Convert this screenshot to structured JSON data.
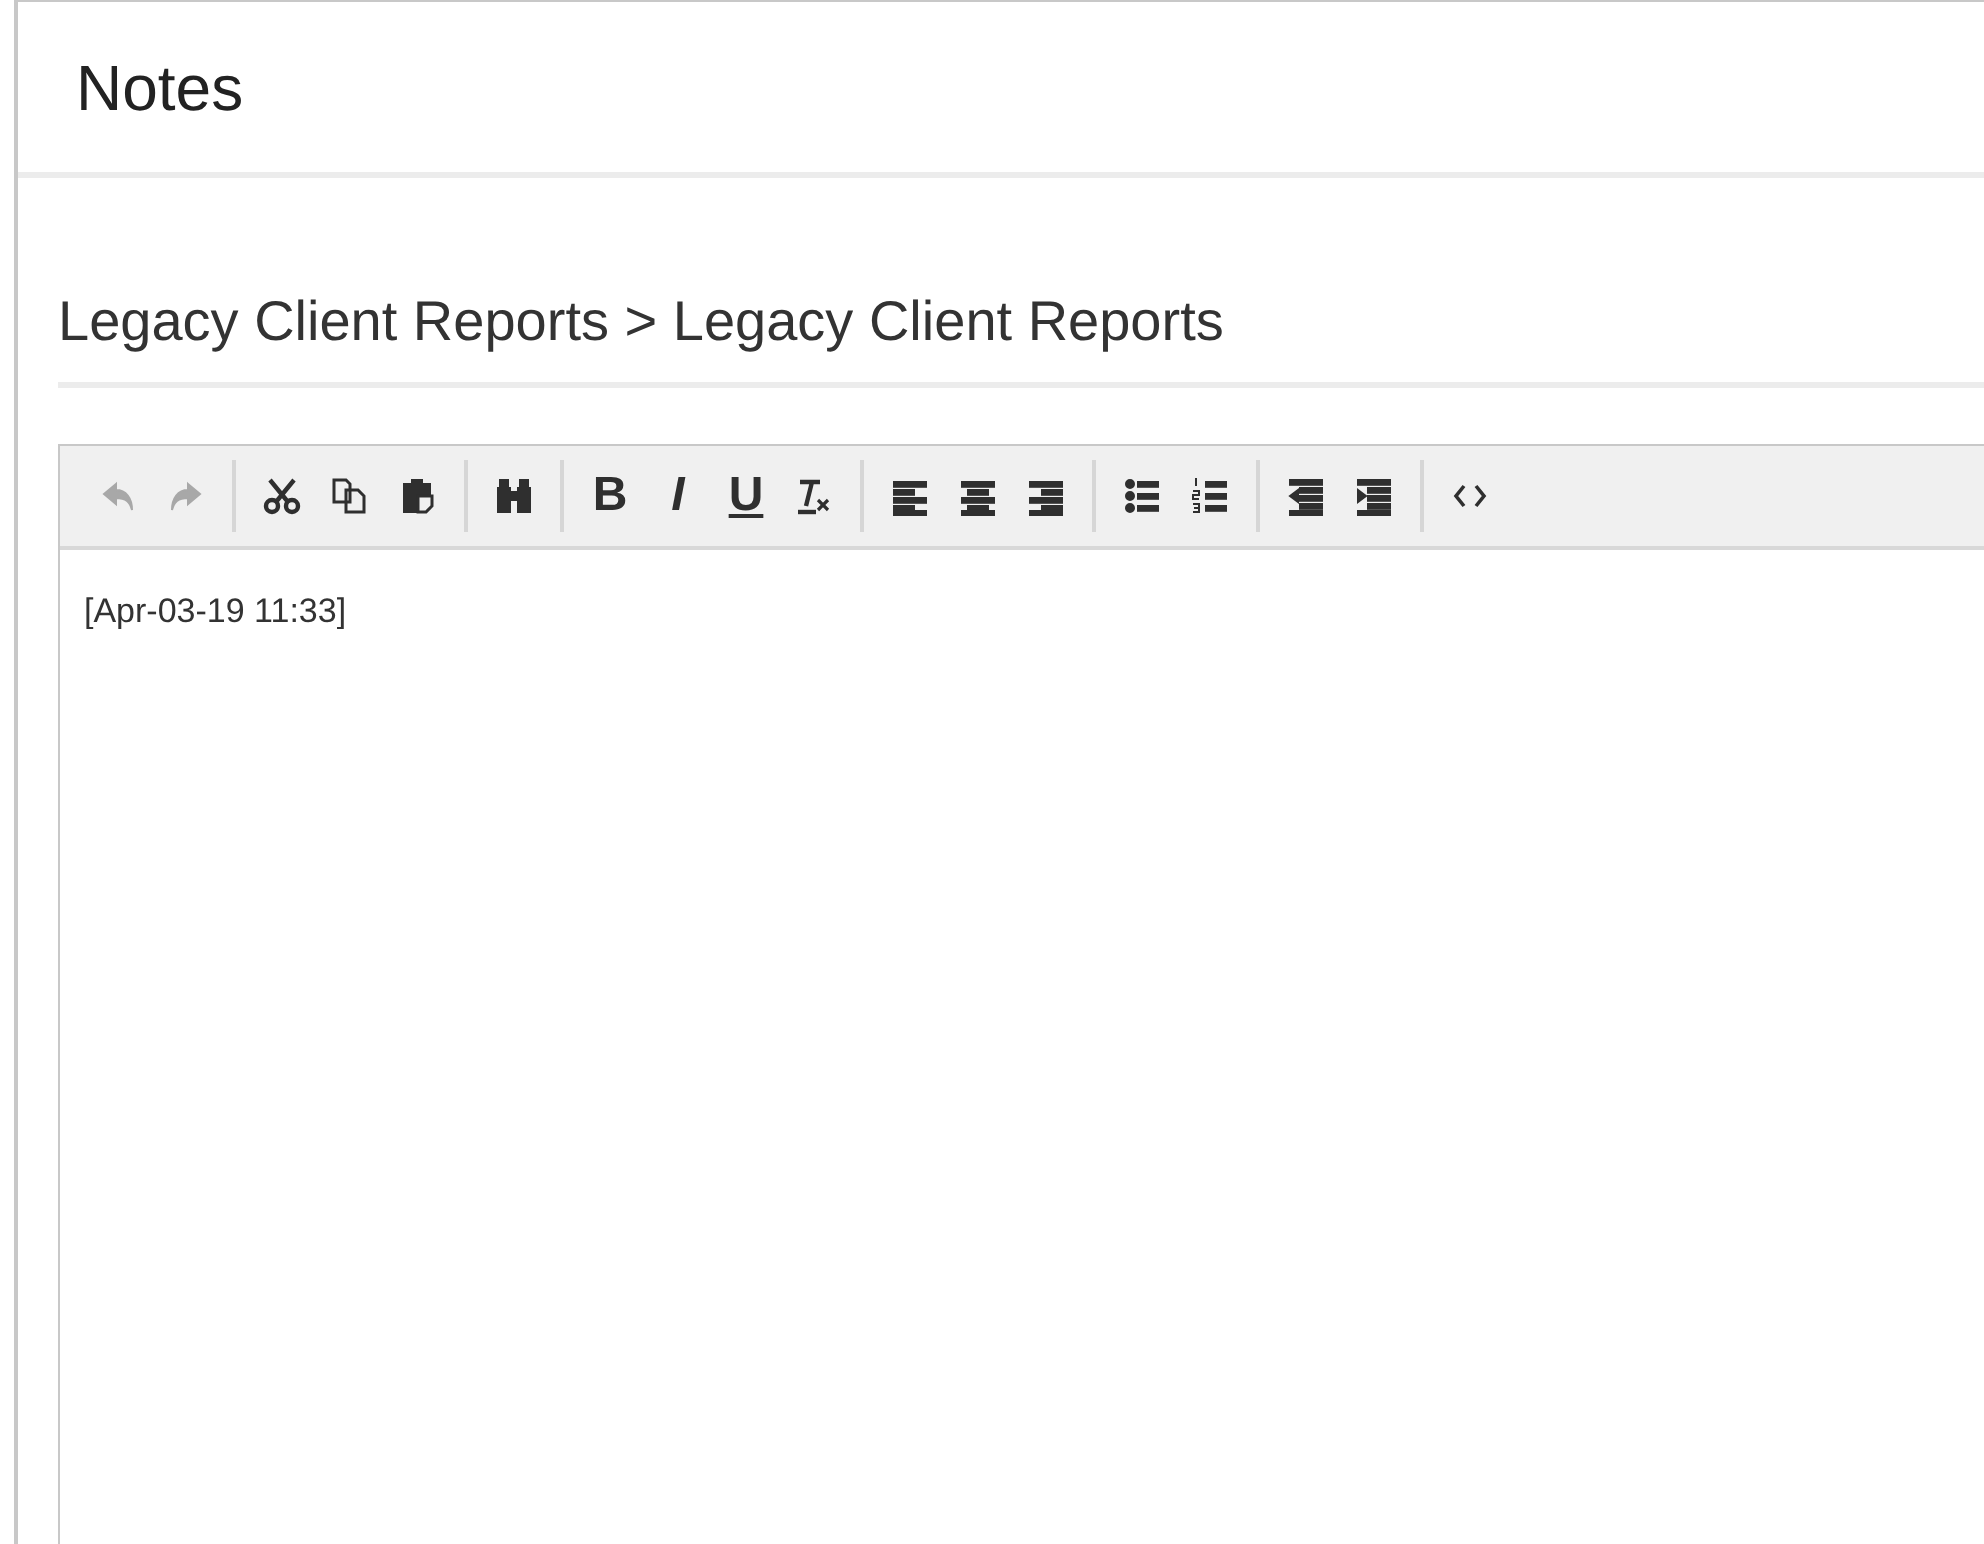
{
  "title": "Notes",
  "breadcrumb": "Legacy Client Reports > Legacy Client Reports",
  "toolbar": [
    [
      {
        "kind": "undo",
        "disabled": true
      },
      {
        "kind": "redo",
        "disabled": true
      }
    ],
    [
      {
        "kind": "cut",
        "disabled": false
      },
      {
        "kind": "copy",
        "disabled": false
      },
      {
        "kind": "paste",
        "disabled": false
      }
    ],
    [
      {
        "kind": "find",
        "disabled": false
      }
    ],
    [
      {
        "kind": "bold",
        "glyph": "B",
        "disabled": false
      },
      {
        "kind": "italic",
        "glyph": "I",
        "disabled": false
      },
      {
        "kind": "underline",
        "glyph": "U",
        "disabled": false
      },
      {
        "kind": "clear-format",
        "disabled": false
      }
    ],
    [
      {
        "kind": "align-left",
        "disabled": false
      },
      {
        "kind": "align-center",
        "disabled": false
      },
      {
        "kind": "align-right",
        "disabled": false
      }
    ],
    [
      {
        "kind": "bullet-list",
        "disabled": false
      },
      {
        "kind": "numbered-list",
        "disabled": false
      }
    ],
    [
      {
        "kind": "outdent",
        "disabled": false
      },
      {
        "kind": "indent",
        "disabled": false
      }
    ],
    [
      {
        "kind": "source",
        "disabled": false
      }
    ]
  ],
  "content": "[Apr-03-19 11:33]"
}
